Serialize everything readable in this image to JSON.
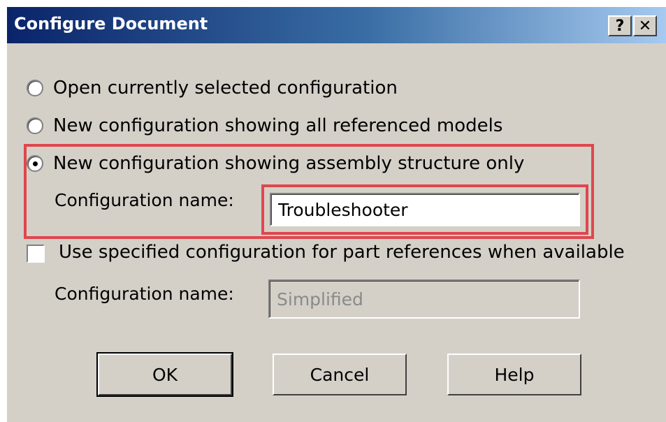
{
  "dialog": {
    "title": "Configure Document",
    "help_glyph": "?",
    "close_glyph": "✕"
  },
  "options": [
    {
      "label": "Open currently selected configuration",
      "selected": false
    },
    {
      "label": "New configuration showing all referenced models",
      "selected": false
    },
    {
      "label": "New configuration showing assembly structure only",
      "selected": true
    }
  ],
  "new_config": {
    "name_label": "Configuration name:",
    "name_value": "Troubleshooter"
  },
  "part_refs": {
    "checkbox_label": "Use specified configuration for part references when available",
    "checked": false,
    "name_label": "Configuration name:",
    "name_value": "Simplified"
  },
  "buttons": {
    "ok": "OK",
    "cancel": "Cancel",
    "help": "Help"
  },
  "colors": {
    "highlight": "#e0464e",
    "dialog_bg": "#d4d0c8",
    "title_start": "#0a246a",
    "title_end": "#a6caf0"
  }
}
